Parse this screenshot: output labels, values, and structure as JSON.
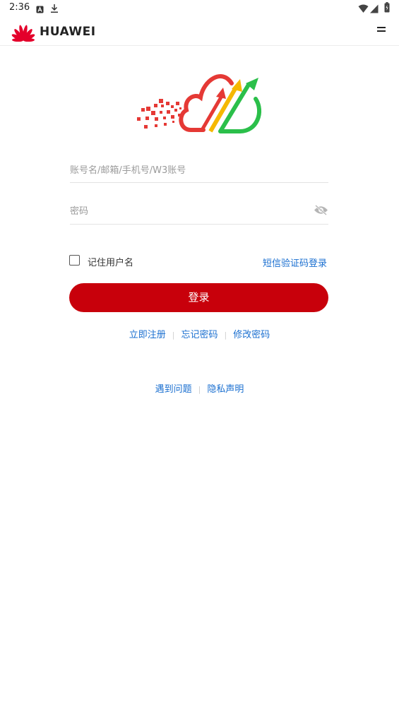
{
  "status_bar": {
    "time": "2:36",
    "left_icons": [
      "notification-a-icon",
      "download-icon"
    ],
    "right_icons": [
      "wifi-icon",
      "signal-icon",
      "battery-icon"
    ]
  },
  "header": {
    "brand": "HUAWEI",
    "brand_color": "#e4002b",
    "menu_icon": "hamburger-menu-icon"
  },
  "logo": {
    "icon": "cloud-growth-logo",
    "colors": {
      "red": "#e53935",
      "yellow": "#f5b800",
      "green": "#2bbf4a"
    }
  },
  "form": {
    "account_placeholder": "账号名/邮箱/手机号/W3账号",
    "account_value": "",
    "password_placeholder": "密码",
    "password_value": "",
    "password_toggle_icon": "eye-hidden-icon",
    "remember_label": "记住用户名",
    "remember_checked": false,
    "sms_login_label": "短信验证码登录",
    "login_button": "登录"
  },
  "links": {
    "register": "立即注册",
    "forgot_password": "忘记密码",
    "change_password": "修改密码",
    "help": "遇到问题",
    "privacy": "隐私声明"
  },
  "colors": {
    "primary": "#c8000b",
    "link": "#1a6fd0"
  }
}
